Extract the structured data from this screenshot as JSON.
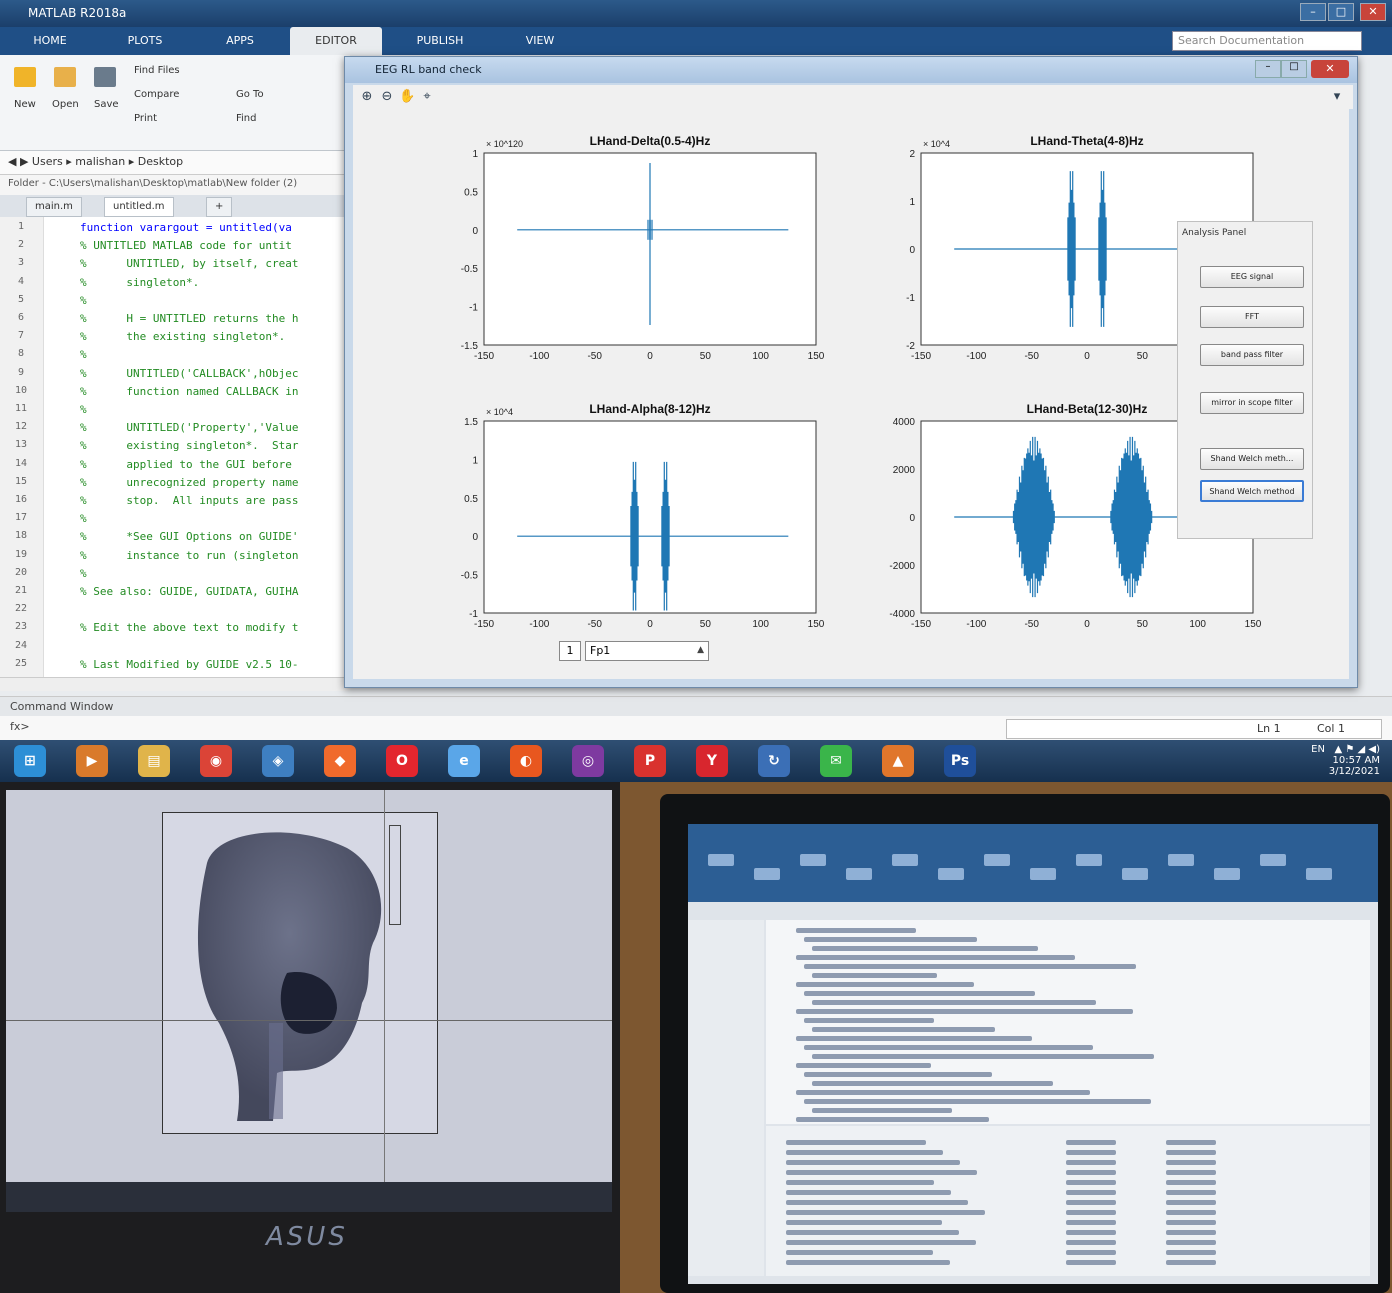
{
  "matlab": {
    "title": "MATLAB R2018a",
    "ribbon_tabs": [
      "HOME",
      "PLOTS",
      "APPS",
      "EDITOR",
      "PUBLISH",
      "VIEW"
    ],
    "active_tab": "EDITOR",
    "search_placeholder": "Search Documentation",
    "ribbon": {
      "new": "New",
      "open": "Open",
      "save": "Save",
      "find_files": "Find Files",
      "compare": "Compare",
      "print": "Print",
      "go_to": "Go To",
      "find": "Find"
    },
    "address": "Users ▸ malishan ▸ Desktop",
    "folder_path": "Folder - C:\\Users\\malishan\\Desktop\\matlab\\New folder (2)",
    "file_tabs": [
      "main.m",
      "untitled.m"
    ],
    "active_file_tab": "untitled.m",
    "editor_lines": [
      {
        "n": "1",
        "text": "function varargout = untitled(va",
        "kw": true
      },
      {
        "n": "2",
        "text": "% UNTITLED MATLAB code for untit"
      },
      {
        "n": "3",
        "text": "%      UNTITLED, by itself, creat"
      },
      {
        "n": "4",
        "text": "%      singleton*."
      },
      {
        "n": "5",
        "text": "%"
      },
      {
        "n": "6",
        "text": "%      H = UNTITLED returns the h"
      },
      {
        "n": "7",
        "text": "%      the existing singleton*."
      },
      {
        "n": "8",
        "text": "%"
      },
      {
        "n": "9",
        "text": "%      UNTITLED('CALLBACK',hObjec"
      },
      {
        "n": "10",
        "text": "%      function named CALLBACK in"
      },
      {
        "n": "11",
        "text": "%"
      },
      {
        "n": "12",
        "text": "%      UNTITLED('Property','Value"
      },
      {
        "n": "13",
        "text": "%      existing singleton*.  Star"
      },
      {
        "n": "14",
        "text": "%      applied to the GUI before"
      },
      {
        "n": "15",
        "text": "%      unrecognized property name"
      },
      {
        "n": "16",
        "text": "%      stop.  All inputs are pass"
      },
      {
        "n": "17",
        "text": "%"
      },
      {
        "n": "18",
        "text": "%      *See GUI Options on GUIDE'"
      },
      {
        "n": "19",
        "text": "%      instance to run (singleton"
      },
      {
        "n": "20",
        "text": "%"
      },
      {
        "n": "21",
        "text": "% See also: GUIDE, GUIDATA, GUIHA"
      },
      {
        "n": "22",
        "text": ""
      },
      {
        "n": "23",
        "text": "% Edit the above text to modify t"
      },
      {
        "n": "24",
        "text": ""
      },
      {
        "n": "25",
        "text": "% Last Modified by GUIDE v2.5 10-"
      }
    ],
    "command_window_label": "Command Window",
    "command_prompt": "fx>",
    "status_ln": "Ln  1",
    "status_col": "Col  1"
  },
  "figure": {
    "title": "EEG RL band check",
    "analysis_panel_title": "Analysis Panel",
    "buttons": [
      "EEG signal",
      "FFT",
      "band pass filter",
      "mirror in scope filter",
      "Shand Welch meth...",
      "Shand Welch method"
    ],
    "channel_number": "1",
    "channel_select": "Fp1",
    "plots": [
      {
        "title": "LHand-Delta(0.5-4)Hz",
        "exponent": "× 10^120",
        "yticks": [
          "1",
          "0.5",
          "0",
          "-0.5",
          "-1",
          "-1.5"
        ]
      },
      {
        "title": "LHand-Theta(4-8)Hz",
        "exponent": "× 10^4",
        "yticks": [
          "2",
          "1",
          "0",
          "-1",
          "-2"
        ]
      },
      {
        "title": "LHand-Alpha(8-12)Hz",
        "exponent": "× 10^4",
        "yticks": [
          "1.5",
          "1",
          "0.5",
          "0",
          "-0.5",
          "-1"
        ]
      },
      {
        "title": "LHand-Beta(12-30)Hz",
        "exponent": "",
        "yticks": [
          "4000",
          "2000",
          "0",
          "-2000",
          "-4000"
        ]
      }
    ],
    "xticks": [
      "-150",
      "-100",
      "-50",
      "0",
      "50",
      "100",
      "150"
    ],
    "trace_color": "#1f77b4"
  },
  "taskbar": {
    "language": "EN",
    "time": "10:57 AM",
    "date": "3/12/2021",
    "icons": [
      "windows-start",
      "media-player",
      "file-explorer",
      "chrome",
      "browser-icon",
      "brave",
      "opera",
      "internet-explorer",
      "app-icon",
      "tor-browser",
      "pinterest",
      "yandex",
      "updater",
      "wechat",
      "matlab",
      "photoshop"
    ]
  },
  "photos": {
    "left_brand": "ASUS"
  }
}
